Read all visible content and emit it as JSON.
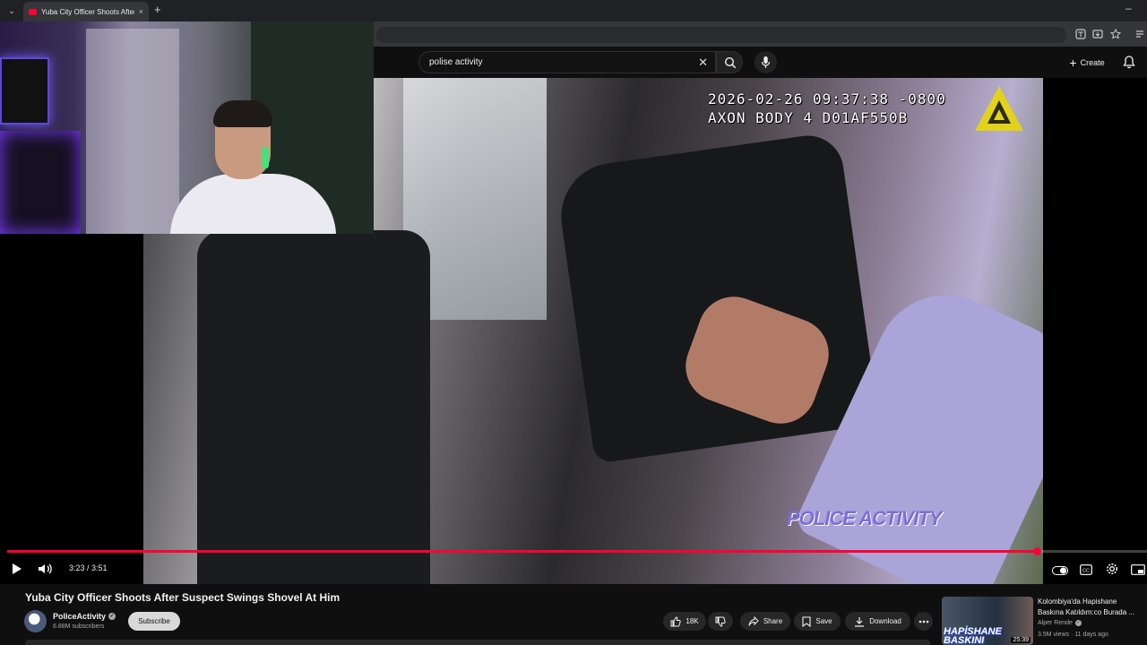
{
  "browser": {
    "tab_title": "Yuba City Officer Shoots After S",
    "tab_close": "×",
    "new_tab": "+",
    "minimize": "–"
  },
  "youtube": {
    "search_value": "polise activity",
    "create_label": "Create",
    "accent": "#ff0033"
  },
  "video": {
    "osd_line1": "2026-02-26 09:37:38 -0800",
    "osd_line2": "AXON BODY 4 D01AF550B",
    "watermark": "POLICE ACTIVITY",
    "current_time": "3:23",
    "duration": "3:51",
    "time_display": "3:23 / 3:51",
    "progress": 0.904
  },
  "meta": {
    "title": "Yuba City Officer Shoots After Suspect Swings Shovel At Him",
    "channel": "PoliceActivity",
    "subscribers": "6.88M subscribers",
    "subscribe_label": "Subscribe",
    "likes": "18K",
    "share_label": "Share",
    "save_label": "Save",
    "download_label": "Download"
  },
  "recommendation": {
    "title": "Kolombiya'da Hapishane Baskına Katıldım:co Burada ...",
    "channel": "Alper Rende",
    "meta": "3.5M views · 11 days ago",
    "duration": "25:39",
    "thumb_text": "HAPİSHANE BASKINI"
  }
}
